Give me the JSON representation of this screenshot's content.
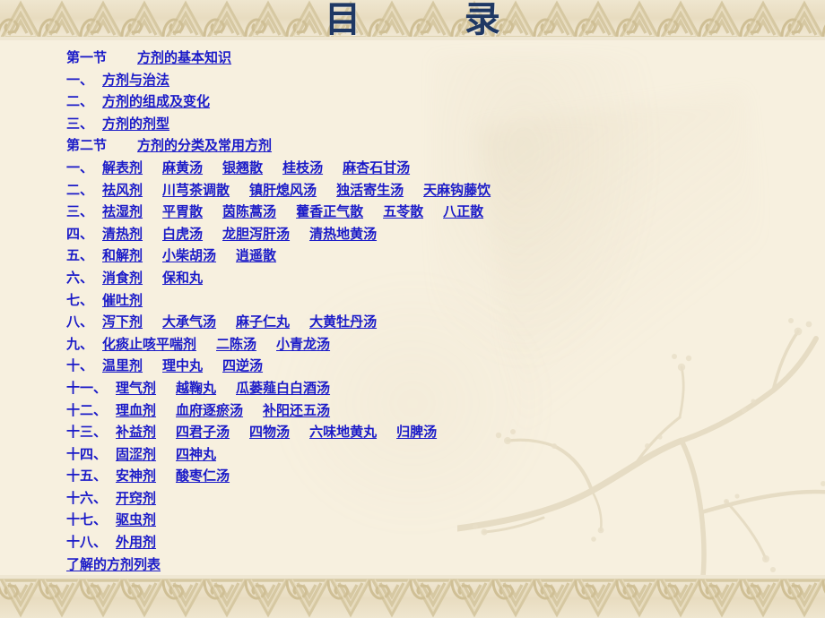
{
  "slide": {
    "title": "目    录",
    "background_color": "#f7f0df",
    "link_color": "#1a1ac8",
    "title_color": "#1f3864",
    "border_color": "#d8cba6"
  },
  "toc": {
    "rows": [
      {
        "prefix": "第一节",
        "gap": "lg",
        "links": [
          "方剂的基本知识"
        ]
      },
      {
        "prefix": "一、",
        "gap": "sm",
        "links": [
          "方剂与治法"
        ]
      },
      {
        "prefix": "二、",
        "gap": "sm",
        "links": [
          "方剂的组成及变化"
        ]
      },
      {
        "prefix": "三、",
        "gap": "sm",
        "links": [
          "方剂的剂型"
        ]
      },
      {
        "prefix": "第二节",
        "gap": "lg",
        "links": [
          "方剂的分类及常用方剂"
        ]
      },
      {
        "prefix": "一、",
        "gap": "sm",
        "links": [
          "解表剂",
          "麻黄汤",
          "银翘散",
          "桂枝汤",
          "麻杏石甘汤"
        ]
      },
      {
        "prefix": "二、",
        "gap": "sm",
        "links": [
          "祛风剂",
          "川芎茶调散",
          "镇肝熄风汤",
          "独活寄生汤",
          "天麻钩藤饮"
        ]
      },
      {
        "prefix": "三、",
        "gap": "sm",
        "links": [
          "祛湿剂",
          "平胃散",
          "茵陈蒿汤",
          "藿香正气散",
          "五苓散",
          "八正散"
        ]
      },
      {
        "prefix": "四、",
        "gap": "sm",
        "links": [
          "清热剂",
          "白虎汤",
          "龙胆泻肝汤",
          "清热地黄汤"
        ]
      },
      {
        "prefix": "五、",
        "gap": "sm",
        "links": [
          "和解剂",
          "小柴胡汤",
          "逍遥散"
        ]
      },
      {
        "prefix": "六、",
        "gap": "sm",
        "links": [
          "消食剂",
          "保和丸"
        ]
      },
      {
        "prefix": "七、",
        "gap": "sm",
        "links": [
          "催吐剂"
        ]
      },
      {
        "prefix": "八、",
        "gap": "sm",
        "links": [
          "泻下剂",
          "大承气汤",
          "麻子仁丸",
          "大黄牡丹汤"
        ]
      },
      {
        "prefix": "九、",
        "gap": "sm",
        "links": [
          "化痰止咳平喘剂",
          "二陈汤",
          "小青龙汤"
        ]
      },
      {
        "prefix": "十、",
        "gap": "sm",
        "links": [
          "温里剂",
          "理中丸",
          "四逆汤"
        ]
      },
      {
        "prefix": "十一、",
        "gap": "sm",
        "links": [
          "理气剂",
          "越鞠丸",
          "瓜蒌薤白白酒汤"
        ]
      },
      {
        "prefix": "十二、",
        "gap": "sm",
        "links": [
          "理血剂",
          "血府逐瘀汤",
          "补阳还五汤"
        ]
      },
      {
        "prefix": "十三、",
        "gap": "sm",
        "links": [
          "补益剂",
          "四君子汤",
          "四物汤",
          "六味地黄丸",
          "归脾汤"
        ]
      },
      {
        "prefix": "十四、",
        "gap": "sm",
        "links": [
          "固涩剂",
          "四神丸"
        ]
      },
      {
        "prefix": "十五、",
        "gap": "sm",
        "links": [
          "安神剂",
          "酸枣仁汤"
        ]
      },
      {
        "prefix": "十六、",
        "gap": "sm",
        "links": [
          "开窍剂"
        ]
      },
      {
        "prefix": "十七、",
        "gap": "sm",
        "links": [
          "驱虫剂"
        ]
      },
      {
        "prefix": "十八、",
        "gap": "sm",
        "links": [
          "外用剂"
        ]
      },
      {
        "prefix": "",
        "gap": "sm",
        "links": [
          "了解的方剂列表"
        ]
      }
    ]
  }
}
